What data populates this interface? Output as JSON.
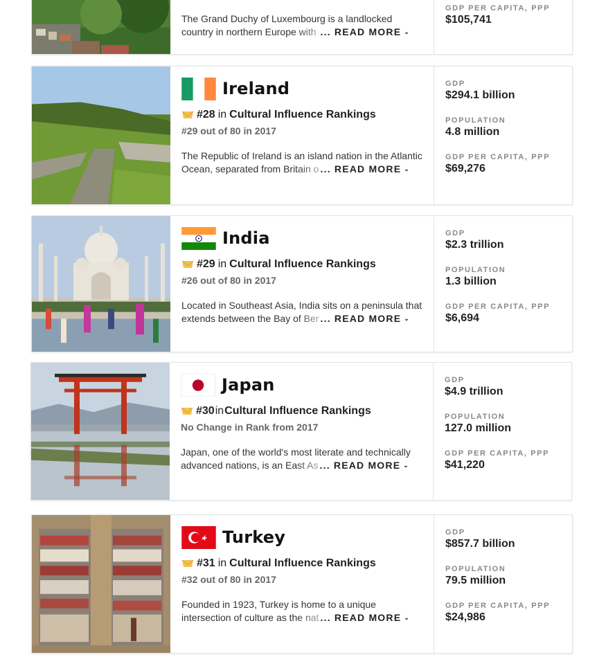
{
  "labels": {
    "gdp": "GDP",
    "population": "POPULATION",
    "gdp_per_capita": "GDP PER CAPITA, PPP",
    "read_more": "... READ MORE",
    "in": "in",
    "category": "Cultural Influence Rankings"
  },
  "luxembourg": {
    "desc_line1": "The Grand Duchy of Luxembourg is a landlocked",
    "desc_line2": "country in northern Europe with Bel",
    "gdp_per_capita": "$105,741"
  },
  "countries": [
    {
      "name": "Ireland",
      "rank": "#28",
      "rank_sub": "#29 out of 80 in 2017",
      "desc_line1": "The Republic of Ireland is an island nation in the Atlantic",
      "desc_line2": "Ocean, separated from Britain on th",
      "gdp": "$294.1 billion",
      "population": "4.8 million",
      "gdp_per_capita": "$69,276"
    },
    {
      "name": "India",
      "rank": "#29",
      "rank_sub": "#26 out of 80 in 2017",
      "desc_line1": "Located in Southeast Asia, India sits on a peninsula that",
      "desc_line2": "extends between the Bay of Bengal",
      "gdp": "$2.3 trillion",
      "population": "1.3 billion",
      "gdp_per_capita": "$6,694"
    },
    {
      "name": "Japan",
      "rank": "#30",
      "rank_sub": "No Change in Rank from 2017",
      "desc_line1": "Japan, one of the world's most literate and technically",
      "desc_line2": "advanced nations, is an East Asian",
      "gdp": "$4.9 trillion",
      "population": "127.0 million",
      "gdp_per_capita": "$41,220"
    },
    {
      "name": "Turkey",
      "rank": "#31",
      "rank_sub": "#32 out of 80 in 2017",
      "desc_line1": "Founded in 1923, Turkey is home to a unique",
      "desc_line2": "intersection of culture as the nation",
      "gdp": "$857.7 billion",
      "population": "79.5 million",
      "gdp_per_capita": "$24,986"
    }
  ],
  "colors": {
    "ireland": [
      "#169b62",
      "#ffffff",
      "#ff883e"
    ],
    "india": [
      "#ff9933",
      "#ffffff",
      "#138808",
      "#000080"
    ],
    "japan": [
      "#ffffff",
      "#bc002d"
    ],
    "turkey": [
      "#e30a17",
      "#ffffff"
    ],
    "badge": "#f2c14e"
  },
  "icons": {
    "badge": "ribbon-badge-icon",
    "chevron": "chevron-down-icon"
  }
}
